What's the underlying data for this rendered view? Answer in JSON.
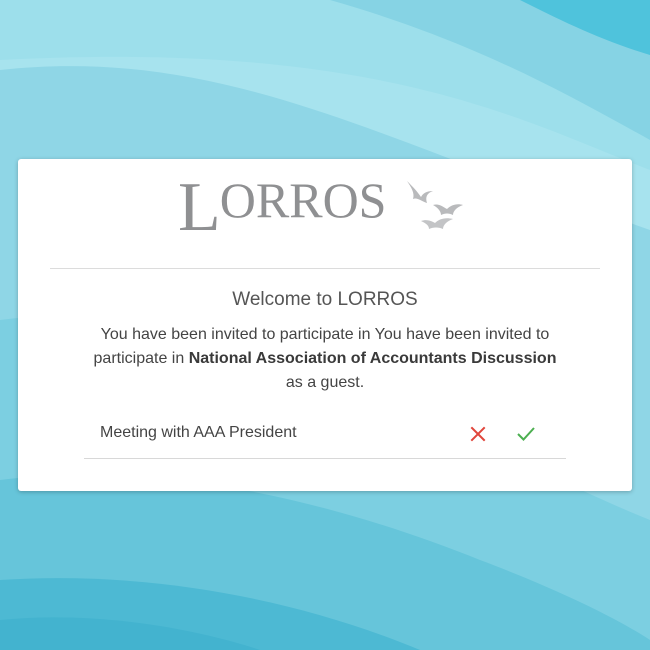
{
  "brand": {
    "logo_text": "LORROS",
    "colors": {
      "logo": "#8f9092",
      "decline": "#e0463c",
      "accept": "#4caf50",
      "background": "#8fd8e6"
    }
  },
  "welcome": {
    "title": "Welcome to LORROS"
  },
  "invite": {
    "prefix": "You have been invited to participate in You have been invited to participate in ",
    "group_name": "National Association of Accountants Discussion",
    "suffix": "as a guest."
  },
  "meeting": {
    "name": "Meeting with AAA President",
    "decline_icon": "close-icon",
    "accept_icon": "check-icon"
  }
}
